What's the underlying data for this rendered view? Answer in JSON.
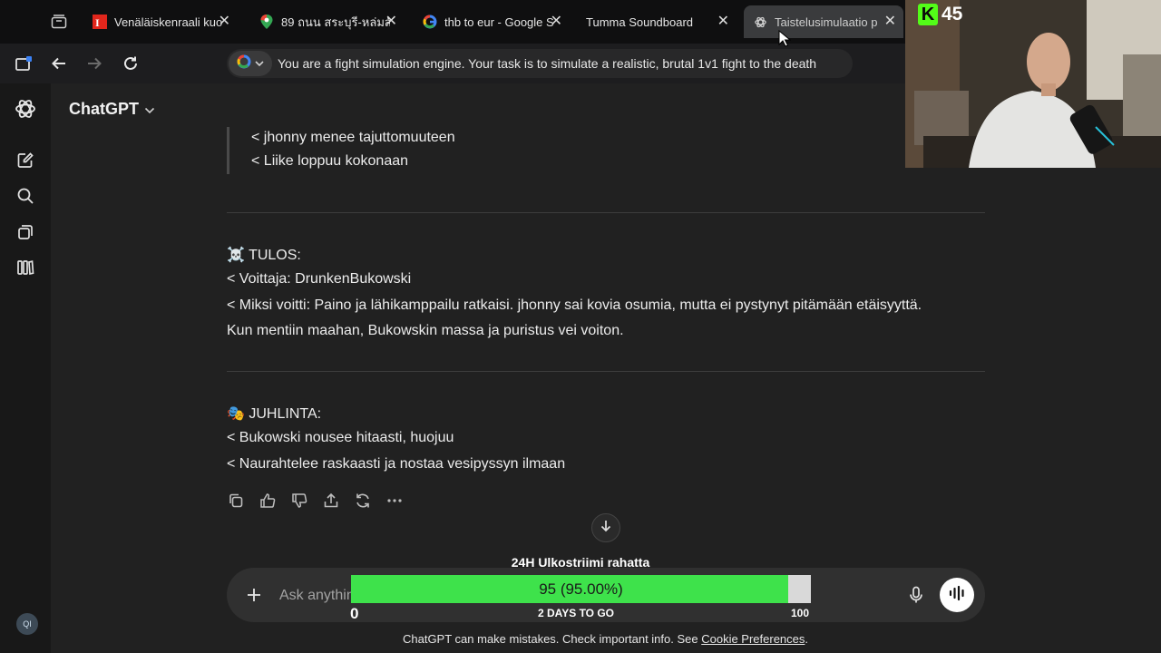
{
  "browser": {
    "tabs": [
      {
        "title": "Venäläiskenraali kuo",
        "icon": "red-news-icon"
      },
      {
        "title": "89 ถนน สระบุรี-หล่มสั",
        "icon": "maps-pin-icon"
      },
      {
        "title": "thb to eur - Google S",
        "icon": "google-icon"
      },
      {
        "title": "Tumma Soundboard",
        "icon": ""
      },
      {
        "title": "Taistelusimulaatio p",
        "icon": "openai-icon"
      }
    ],
    "address": "You are a fight simulation engine.  Your task is to simulate a realistic, brutal 1v1 fight to the death"
  },
  "stream": {
    "viewer_count": "45"
  },
  "app": {
    "model_name": "ChatGPT"
  },
  "avatar_initials": "QI",
  "conversation": {
    "quote_lines": [
      "< jhonny menee tajuttomuuteen",
      "< Liike loppuu kokonaan"
    ],
    "result_heading": "☠️ TULOS:",
    "result_lines": [
      "< Voittaja: DrunkenBukowski",
      "< Miksi voitti: Paino ja lähikamppailu ratkaisi. jhonny sai kovia osumia, mutta ei pystynyt pitämään etäisyyttä.",
      "Kun mentiin maahan, Bukowskin massa ja puristus vei voiton."
    ],
    "celebration_heading": "🎭 JUHLINTA:",
    "celebration_lines": [
      "< Bukowski nousee hitaasti, huojuu",
      "< Naurahtelee raskaasti ja nostaa vesipyssyn ilmaan"
    ]
  },
  "composer": {
    "placeholder": "Ask anything"
  },
  "goal": {
    "title": "24H Ulkostriimi rahatta",
    "value_text": "95 (95.00%)",
    "progress_fraction": 0.95,
    "min": "0",
    "deadline": "2 DAYS TO GO",
    "max": "100"
  },
  "footer": {
    "text": "ChatGPT can make mistakes. Check important info. See ",
    "link": "Cookie Preferences",
    "end": "."
  },
  "colors": {
    "kick_green": "#53fc18",
    "goal_fill": "#3ee24b"
  }
}
